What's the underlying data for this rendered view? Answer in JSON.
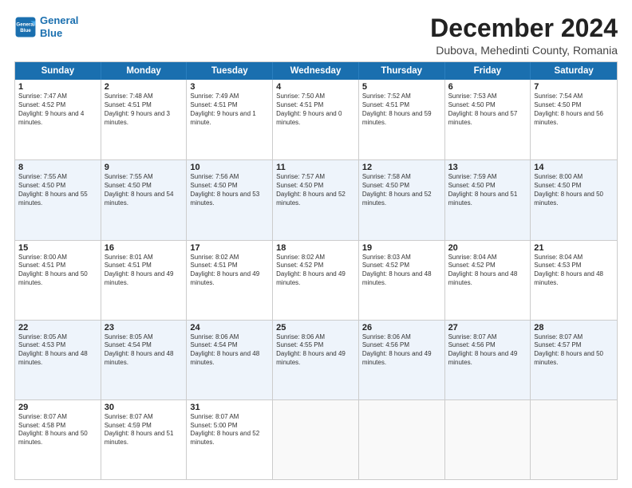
{
  "logo": {
    "line1": "General",
    "line2": "Blue"
  },
  "title": "December 2024",
  "subtitle": "Dubova, Mehedinti County, Romania",
  "header_days": [
    "Sunday",
    "Monday",
    "Tuesday",
    "Wednesday",
    "Thursday",
    "Friday",
    "Saturday"
  ],
  "weeks": [
    [
      {
        "day": "1",
        "sunrise": "Sunrise: 7:47 AM",
        "sunset": "Sunset: 4:52 PM",
        "daylight": "Daylight: 9 hours and 4 minutes."
      },
      {
        "day": "2",
        "sunrise": "Sunrise: 7:48 AM",
        "sunset": "Sunset: 4:51 PM",
        "daylight": "Daylight: 9 hours and 3 minutes."
      },
      {
        "day": "3",
        "sunrise": "Sunrise: 7:49 AM",
        "sunset": "Sunset: 4:51 PM",
        "daylight": "Daylight: 9 hours and 1 minute."
      },
      {
        "day": "4",
        "sunrise": "Sunrise: 7:50 AM",
        "sunset": "Sunset: 4:51 PM",
        "daylight": "Daylight: 9 hours and 0 minutes."
      },
      {
        "day": "5",
        "sunrise": "Sunrise: 7:52 AM",
        "sunset": "Sunset: 4:51 PM",
        "daylight": "Daylight: 8 hours and 59 minutes."
      },
      {
        "day": "6",
        "sunrise": "Sunrise: 7:53 AM",
        "sunset": "Sunset: 4:50 PM",
        "daylight": "Daylight: 8 hours and 57 minutes."
      },
      {
        "day": "7",
        "sunrise": "Sunrise: 7:54 AM",
        "sunset": "Sunset: 4:50 PM",
        "daylight": "Daylight: 8 hours and 56 minutes."
      }
    ],
    [
      {
        "day": "8",
        "sunrise": "Sunrise: 7:55 AM",
        "sunset": "Sunset: 4:50 PM",
        "daylight": "Daylight: 8 hours and 55 minutes."
      },
      {
        "day": "9",
        "sunrise": "Sunrise: 7:55 AM",
        "sunset": "Sunset: 4:50 PM",
        "daylight": "Daylight: 8 hours and 54 minutes."
      },
      {
        "day": "10",
        "sunrise": "Sunrise: 7:56 AM",
        "sunset": "Sunset: 4:50 PM",
        "daylight": "Daylight: 8 hours and 53 minutes."
      },
      {
        "day": "11",
        "sunrise": "Sunrise: 7:57 AM",
        "sunset": "Sunset: 4:50 PM",
        "daylight": "Daylight: 8 hours and 52 minutes."
      },
      {
        "day": "12",
        "sunrise": "Sunrise: 7:58 AM",
        "sunset": "Sunset: 4:50 PM",
        "daylight": "Daylight: 8 hours and 52 minutes."
      },
      {
        "day": "13",
        "sunrise": "Sunrise: 7:59 AM",
        "sunset": "Sunset: 4:50 PM",
        "daylight": "Daylight: 8 hours and 51 minutes."
      },
      {
        "day": "14",
        "sunrise": "Sunrise: 8:00 AM",
        "sunset": "Sunset: 4:50 PM",
        "daylight": "Daylight: 8 hours and 50 minutes."
      }
    ],
    [
      {
        "day": "15",
        "sunrise": "Sunrise: 8:00 AM",
        "sunset": "Sunset: 4:51 PM",
        "daylight": "Daylight: 8 hours and 50 minutes."
      },
      {
        "day": "16",
        "sunrise": "Sunrise: 8:01 AM",
        "sunset": "Sunset: 4:51 PM",
        "daylight": "Daylight: 8 hours and 49 minutes."
      },
      {
        "day": "17",
        "sunrise": "Sunrise: 8:02 AM",
        "sunset": "Sunset: 4:51 PM",
        "daylight": "Daylight: 8 hours and 49 minutes."
      },
      {
        "day": "18",
        "sunrise": "Sunrise: 8:02 AM",
        "sunset": "Sunset: 4:52 PM",
        "daylight": "Daylight: 8 hours and 49 minutes."
      },
      {
        "day": "19",
        "sunrise": "Sunrise: 8:03 AM",
        "sunset": "Sunset: 4:52 PM",
        "daylight": "Daylight: 8 hours and 48 minutes."
      },
      {
        "day": "20",
        "sunrise": "Sunrise: 8:04 AM",
        "sunset": "Sunset: 4:52 PM",
        "daylight": "Daylight: 8 hours and 48 minutes."
      },
      {
        "day": "21",
        "sunrise": "Sunrise: 8:04 AM",
        "sunset": "Sunset: 4:53 PM",
        "daylight": "Daylight: 8 hours and 48 minutes."
      }
    ],
    [
      {
        "day": "22",
        "sunrise": "Sunrise: 8:05 AM",
        "sunset": "Sunset: 4:53 PM",
        "daylight": "Daylight: 8 hours and 48 minutes."
      },
      {
        "day": "23",
        "sunrise": "Sunrise: 8:05 AM",
        "sunset": "Sunset: 4:54 PM",
        "daylight": "Daylight: 8 hours and 48 minutes."
      },
      {
        "day": "24",
        "sunrise": "Sunrise: 8:06 AM",
        "sunset": "Sunset: 4:54 PM",
        "daylight": "Daylight: 8 hours and 48 minutes."
      },
      {
        "day": "25",
        "sunrise": "Sunrise: 8:06 AM",
        "sunset": "Sunset: 4:55 PM",
        "daylight": "Daylight: 8 hours and 49 minutes."
      },
      {
        "day": "26",
        "sunrise": "Sunrise: 8:06 AM",
        "sunset": "Sunset: 4:56 PM",
        "daylight": "Daylight: 8 hours and 49 minutes."
      },
      {
        "day": "27",
        "sunrise": "Sunrise: 8:07 AM",
        "sunset": "Sunset: 4:56 PM",
        "daylight": "Daylight: 8 hours and 49 minutes."
      },
      {
        "day": "28",
        "sunrise": "Sunrise: 8:07 AM",
        "sunset": "Sunset: 4:57 PM",
        "daylight": "Daylight: 8 hours and 50 minutes."
      }
    ],
    [
      {
        "day": "29",
        "sunrise": "Sunrise: 8:07 AM",
        "sunset": "Sunset: 4:58 PM",
        "daylight": "Daylight: 8 hours and 50 minutes."
      },
      {
        "day": "30",
        "sunrise": "Sunrise: 8:07 AM",
        "sunset": "Sunset: 4:59 PM",
        "daylight": "Daylight: 8 hours and 51 minutes."
      },
      {
        "day": "31",
        "sunrise": "Sunrise: 8:07 AM",
        "sunset": "Sunset: 5:00 PM",
        "daylight": "Daylight: 8 hours and 52 minutes."
      },
      null,
      null,
      null,
      null
    ]
  ]
}
